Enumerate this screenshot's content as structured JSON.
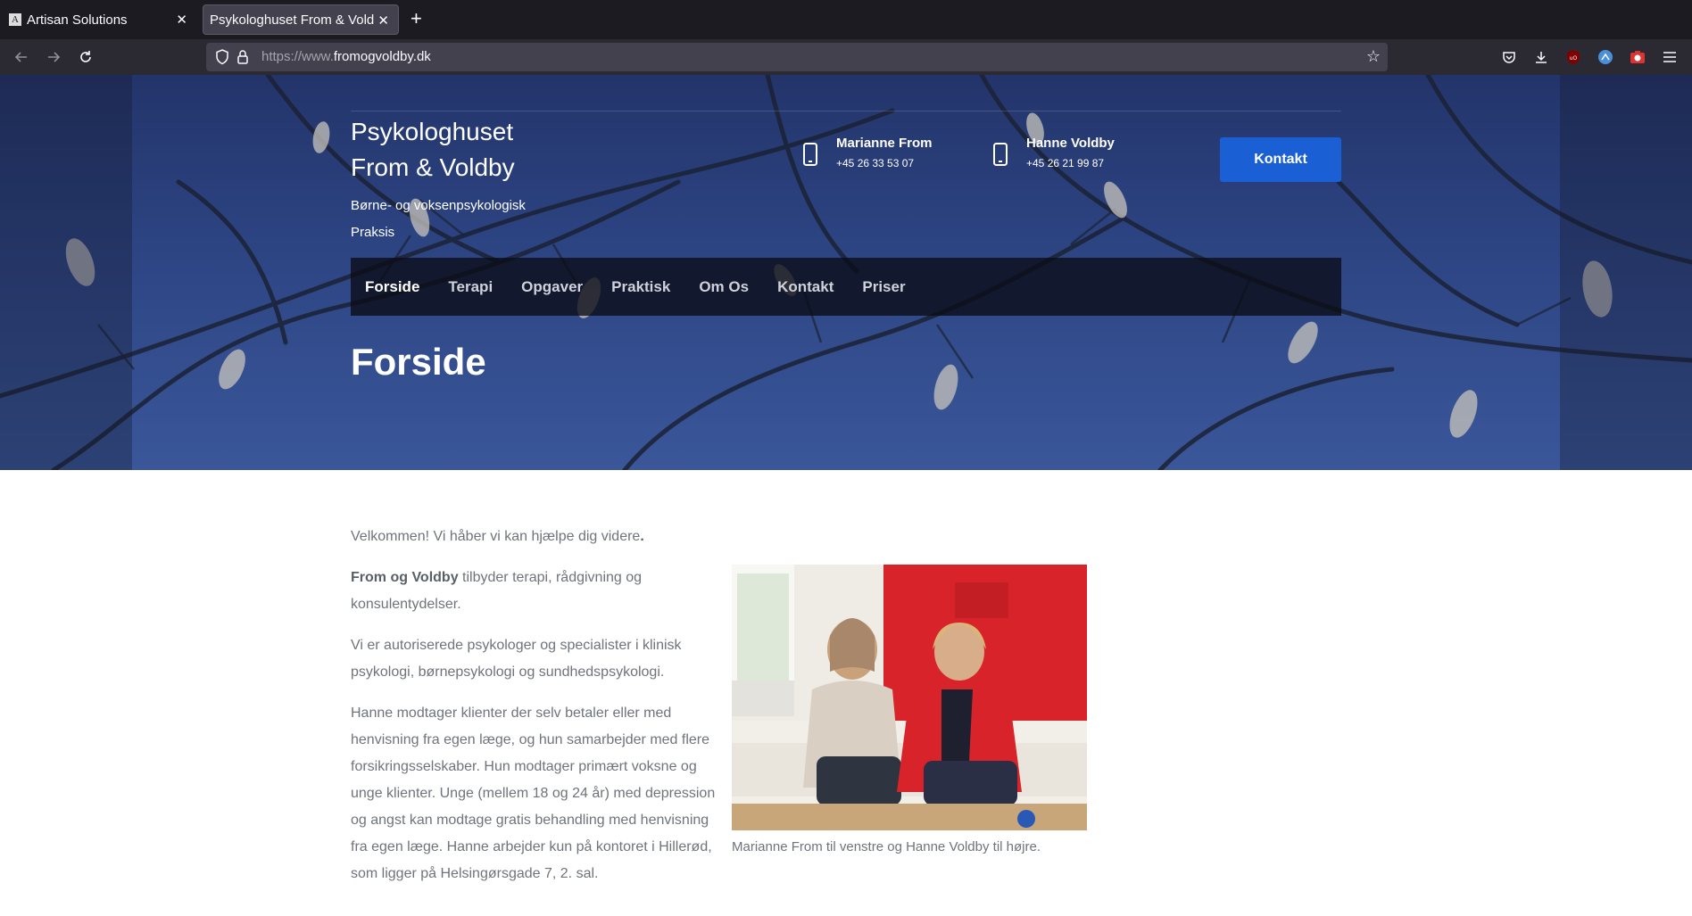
{
  "browser": {
    "tabs": [
      {
        "title": "Artisan Solutions",
        "favicon": "A",
        "active": false
      },
      {
        "title": "Psykologhuset From & Voldby",
        "active": true
      }
    ],
    "url_prefix": "https://www.",
    "url_domain": "fromogvoldby.dk"
  },
  "header": {
    "brand_line1": "Psykologhuset",
    "brand_line2": "From & Voldby",
    "tagline": "Børne- og voksenpsykologisk Praksis",
    "contacts": [
      {
        "name": "Marianne From",
        "phone": "+45 26 33 53 07"
      },
      {
        "name": "Hanne Voldby",
        "phone": "+45 26 21 99 87"
      }
    ],
    "cta_label": "Kontakt"
  },
  "nav": {
    "items": [
      "Forside",
      "Terapi",
      "Opgaver",
      "Praktisk",
      "Om Os",
      "Kontakt",
      "Priser"
    ],
    "active_index": 0
  },
  "hero": {
    "title": "Forside"
  },
  "main": {
    "intro_text": "Velkommen! Vi håber vi kan hjælpe dig videre",
    "intro_punct": ".",
    "p2_bold": "From og Voldby",
    "p2_rest": " tilbyder terapi, rådgivning og konsulentydelser.",
    "p3": "Vi er autoriserede psykologer og specialister i klinisk psykologi, børnepsykologi og sundhedspsykologi.",
    "p4": "Hanne modtager klienter der selv betaler eller med henvisning fra egen læge, og hun samarbejder med flere forsikringsselskaber. Hun modtager primært voksne og unge klienter. Unge (mellem 18 og 24 år) med depression og angst kan modtage gratis behandling med henvisning fra egen læge. Hanne arbejder kun på kontoret i Hillerød, som ligger på Helsingørsgade 7, 2. sal.",
    "photo_caption": "Marianne From til venstre og Hanne Voldby til højre."
  },
  "colors": {
    "brand_blue": "#1a5fd4",
    "hero_bg": "#2c4381",
    "text_gray": "#6f747a"
  }
}
